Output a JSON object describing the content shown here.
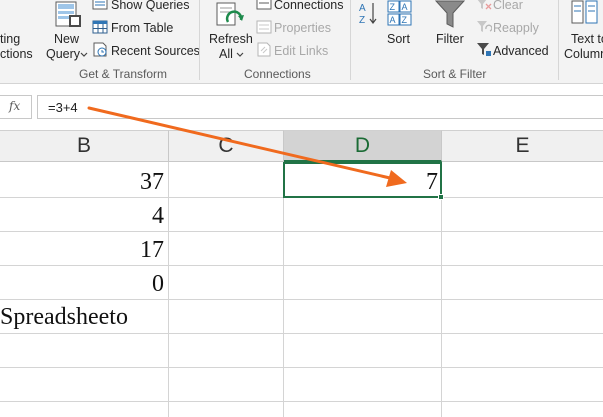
{
  "ribbon": {
    "get_existing": {
      "line1": "ting",
      "line2": "ctions"
    },
    "new_query": {
      "line1": "New",
      "line2": "Query"
    },
    "show_queries": "Show Queries",
    "from_table": "From Table",
    "recent_sources": "Recent Sources",
    "group_get_transform": "Get & Transform",
    "refresh": {
      "line1": "Refresh",
      "line2": "All"
    },
    "connections": "Connections",
    "properties": "Properties",
    "edit_links": "Edit Links",
    "group_connections": "Connections",
    "sort": "Sort",
    "filter": "Filter",
    "clear": "Clear",
    "reapply": "Reapply",
    "advanced": "Advanced",
    "group_sort_filter": "Sort & Filter",
    "text_to_columns": {
      "line1": "Text to",
      "line2": "Column"
    }
  },
  "formula_bar": {
    "fx_label": "fx",
    "formula": "=3+4"
  },
  "columns": [
    "B",
    "C",
    "D",
    "E"
  ],
  "selected_column": "D",
  "cells": {
    "b1": "37",
    "b2": "4",
    "b3": "17",
    "b4": "0",
    "b5": "Spreadsheeto",
    "d1": "7"
  },
  "colors": {
    "accent": "#217346",
    "arrow": "#f06a1e"
  }
}
